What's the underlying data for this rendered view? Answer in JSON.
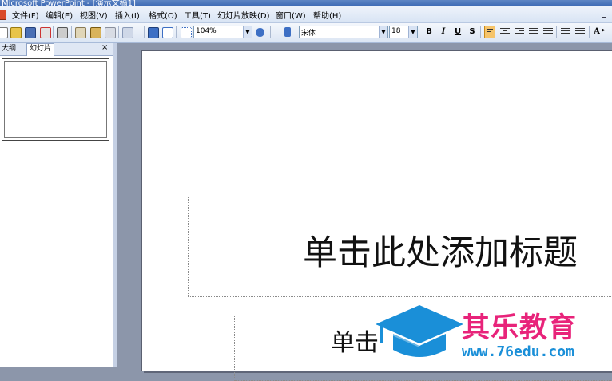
{
  "window": {
    "title": "Microsoft PowerPoint - [演示文稿1]"
  },
  "menu": {
    "items": [
      {
        "label": "文件(F)"
      },
      {
        "label": "编辑(E)"
      },
      {
        "label": "视图(V)"
      },
      {
        "label": "插入(I)"
      },
      {
        "label": "格式(O)"
      },
      {
        "label": "工具(T)"
      },
      {
        "label": "幻灯片放映(D)"
      },
      {
        "label": "窗口(W)"
      },
      {
        "label": "帮助(H)"
      }
    ]
  },
  "toolbar": {
    "zoom": "104%",
    "font_name": "宋体",
    "font_size": "18",
    "bold": "B",
    "italic": "I",
    "underline": "U",
    "shadow": "S",
    "grow_font": "A"
  },
  "pane": {
    "tabs": [
      {
        "label": "大纲"
      },
      {
        "label": "幻灯片"
      }
    ],
    "active_tab": "幻灯片",
    "close": "×"
  },
  "slide": {
    "title_placeholder": "单击此处添加标题",
    "subtitle_placeholder": "单击"
  },
  "watermark": {
    "brand": "其乐教育",
    "url": "www.76edu.com",
    "colors": {
      "brand": "#e8237a",
      "cap": "#1a8fd8"
    }
  },
  "colors": {
    "accent": "#3c69b4",
    "workspace": "#8c96aa"
  }
}
